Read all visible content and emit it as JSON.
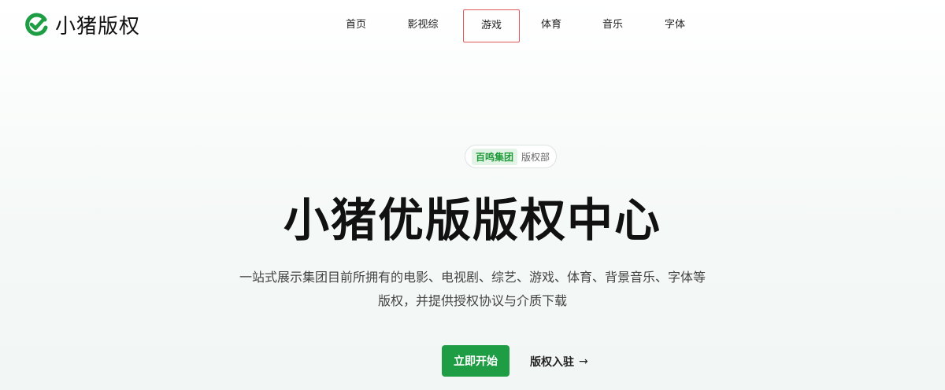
{
  "logo": {
    "text": "小猪版权",
    "brand_color": "#1e9d44"
  },
  "nav": {
    "items": [
      {
        "label": "首页"
      },
      {
        "label": "影视综"
      },
      {
        "label": "游戏",
        "active": true
      },
      {
        "label": "体育"
      },
      {
        "label": "音乐"
      },
      {
        "label": "字体"
      }
    ]
  },
  "hero": {
    "badge_tag": "百鸣集团",
    "badge_text": "版权部",
    "title": "小猪优版版权中心",
    "description_line1": "一站式展示集团目前所拥有的电影、电视剧、综艺、游戏、体育、背景音乐、字体等",
    "description_line2": "版权，并提供授权协议与介质下载",
    "cta_label": "立即开始",
    "secondary_label": "版权入驻",
    "secondary_arrow": "→"
  },
  "colors": {
    "accent": "#1e9d44",
    "active_border": "#e05757"
  }
}
